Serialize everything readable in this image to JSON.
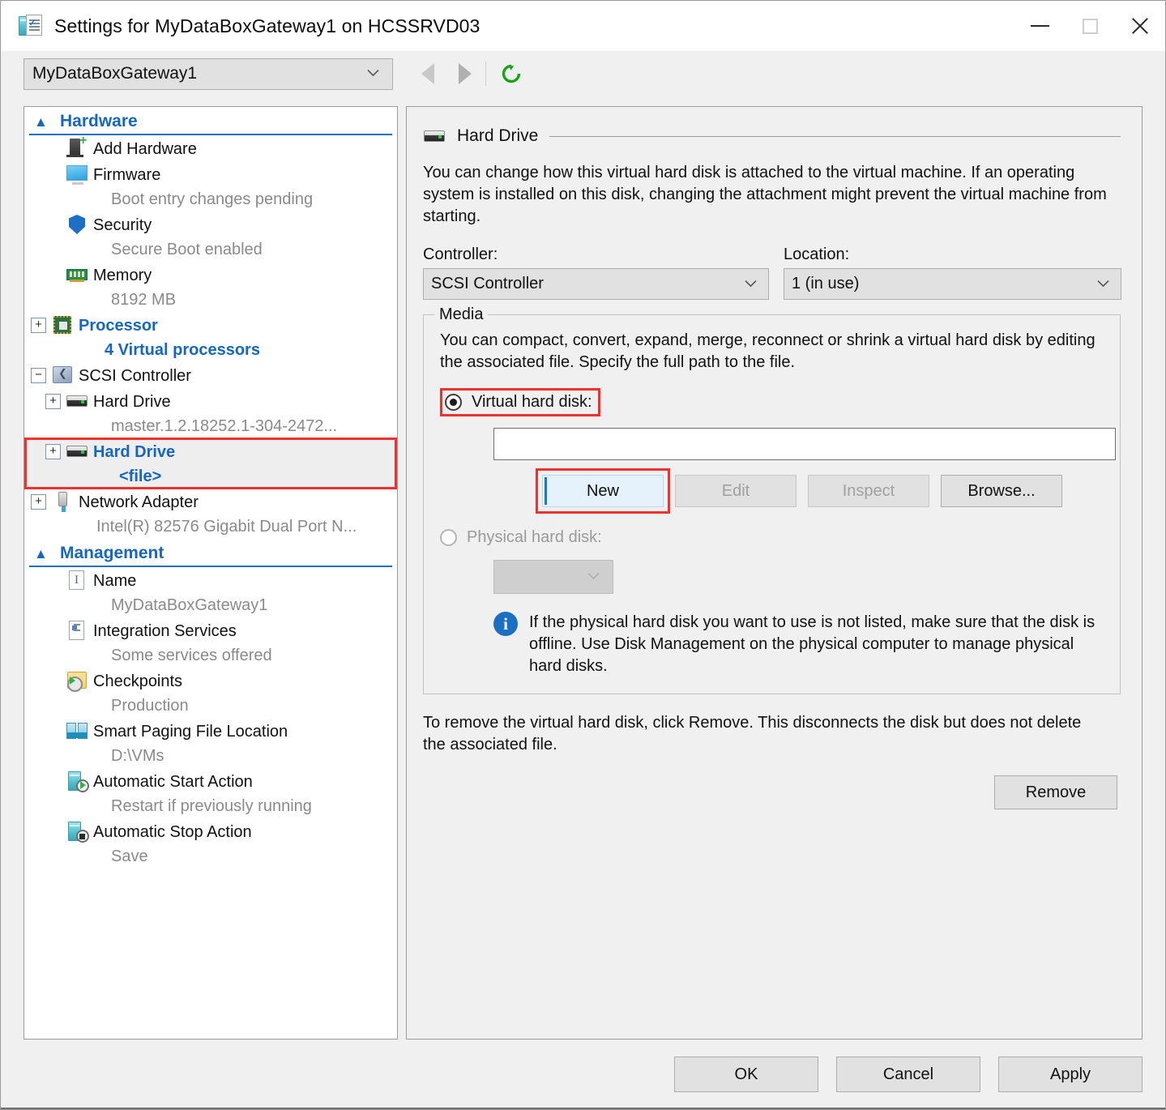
{
  "window": {
    "title": "Settings for MyDataBoxGateway1 on HCSSRVD03",
    "icon": "vm-settings-icon",
    "controls": {
      "minimize": "—",
      "maximize": "□",
      "close": "✕"
    }
  },
  "toolbar": {
    "vm_selector_value": "MyDataBoxGateway1",
    "back_label": "Back",
    "forward_label": "Forward",
    "refresh_label": "Refresh"
  },
  "sidebar": {
    "sections": [
      {
        "id": "hardware",
        "title": "Hardware",
        "items": [
          {
            "label": "Add Hardware",
            "sub": "",
            "icon": "add-hardware-icon",
            "expander": "",
            "indent": 1,
            "selected": false,
            "blue": false
          },
          {
            "label": "Firmware",
            "sub": "Boot entry changes pending",
            "icon": "firmware-icon",
            "expander": "",
            "indent": 1,
            "selected": false,
            "blue": false
          },
          {
            "label": "Security",
            "sub": "Secure Boot enabled",
            "icon": "security-shield-icon",
            "expander": "",
            "indent": 1,
            "selected": false,
            "blue": false
          },
          {
            "label": "Memory",
            "sub": "8192 MB",
            "icon": "memory-icon",
            "expander": "",
            "indent": 1,
            "selected": false,
            "blue": false
          },
          {
            "label": "Processor",
            "sub": "4 Virtual processors",
            "icon": "processor-icon",
            "expander": "+",
            "indent": 0,
            "selected": false,
            "blue": true
          },
          {
            "label": "SCSI Controller",
            "sub": "",
            "icon": "scsi-controller-icon",
            "expander": "−",
            "indent": 0,
            "selected": false,
            "blue": false
          },
          {
            "label": "Hard Drive",
            "sub": "master.1.2.18252.1-304-2472...",
            "icon": "hard-drive-icon",
            "expander": "+",
            "indent": 1,
            "selected": false,
            "blue": false
          },
          {
            "label": "Hard Drive",
            "sub": "<file>",
            "icon": "hard-drive-icon",
            "expander": "+",
            "indent": 1,
            "selected": true,
            "blue": true
          },
          {
            "label": "Network Adapter",
            "sub": "Intel(R) 82576 Gigabit Dual Port N...",
            "icon": "network-adapter-icon",
            "expander": "+",
            "indent": 0,
            "selected": false,
            "blue": false
          }
        ]
      },
      {
        "id": "management",
        "title": "Management",
        "items": [
          {
            "label": "Name",
            "sub": "MyDataBoxGateway1",
            "icon": "name-icon",
            "expander": "",
            "indent": 1,
            "selected": false,
            "blue": false
          },
          {
            "label": "Integration Services",
            "sub": "Some services offered",
            "icon": "integration-services-icon",
            "expander": "",
            "indent": 1,
            "selected": false,
            "blue": false
          },
          {
            "label": "Checkpoints",
            "sub": "Production",
            "icon": "checkpoints-icon",
            "expander": "",
            "indent": 1,
            "selected": false,
            "blue": false
          },
          {
            "label": "Smart Paging File Location",
            "sub": "D:\\VMs",
            "icon": "smart-paging-icon",
            "expander": "",
            "indent": 1,
            "selected": false,
            "blue": false
          },
          {
            "label": "Automatic Start Action",
            "sub": "Restart if previously running",
            "icon": "auto-start-icon",
            "expander": "",
            "indent": 1,
            "selected": false,
            "blue": false
          },
          {
            "label": "Automatic Stop Action",
            "sub": "Save",
            "icon": "auto-stop-icon",
            "expander": "",
            "indent": 1,
            "selected": false,
            "blue": false
          }
        ]
      }
    ]
  },
  "main": {
    "header": "Hard Drive",
    "header_icon": "hard-drive-icon",
    "description": "You can change how this virtual hard disk is attached to the virtual machine. If an operating system is installed on this disk, changing the attachment might prevent the virtual machine from starting.",
    "controller_label": "Controller:",
    "controller_value": "SCSI Controller",
    "location_label": "Location:",
    "location_value": "1 (in use)",
    "media": {
      "legend": "Media",
      "description": "You can compact, convert, expand, merge, reconnect or shrink a virtual hard disk by editing the associated file. Specify the full path to the file.",
      "virtual_radio_label": "Virtual hard disk:",
      "virtual_radio_checked": true,
      "path_value": "",
      "path_placeholder": "",
      "buttons": [
        {
          "label": "New",
          "state": "focused"
        },
        {
          "label": "Edit",
          "state": "disabled"
        },
        {
          "label": "Inspect",
          "state": "disabled"
        },
        {
          "label": "Browse...",
          "state": "enabled"
        }
      ],
      "physical_radio_label": "Physical hard disk:",
      "physical_radio_checked": false,
      "physical_combo_value": "",
      "info_icon": "info-icon",
      "info_text": "If the physical hard disk you want to use is not listed, make sure that the disk is offline. Use Disk Management on the physical computer to manage physical hard disks."
    },
    "remove_note": "To remove the virtual hard disk, click Remove. This disconnects the disk but does not delete the associated file.",
    "remove_button": "Remove"
  },
  "footer": {
    "ok": "OK",
    "cancel": "Cancel",
    "apply": "Apply"
  },
  "colors": {
    "accent_blue": "#1567bf",
    "highlight_red": "#f2302f",
    "window_bg": "#f0f0f0",
    "focus_blue": "#1979ca",
    "info_blue": "#1b6ec2",
    "refresh_green": "#18a318"
  }
}
